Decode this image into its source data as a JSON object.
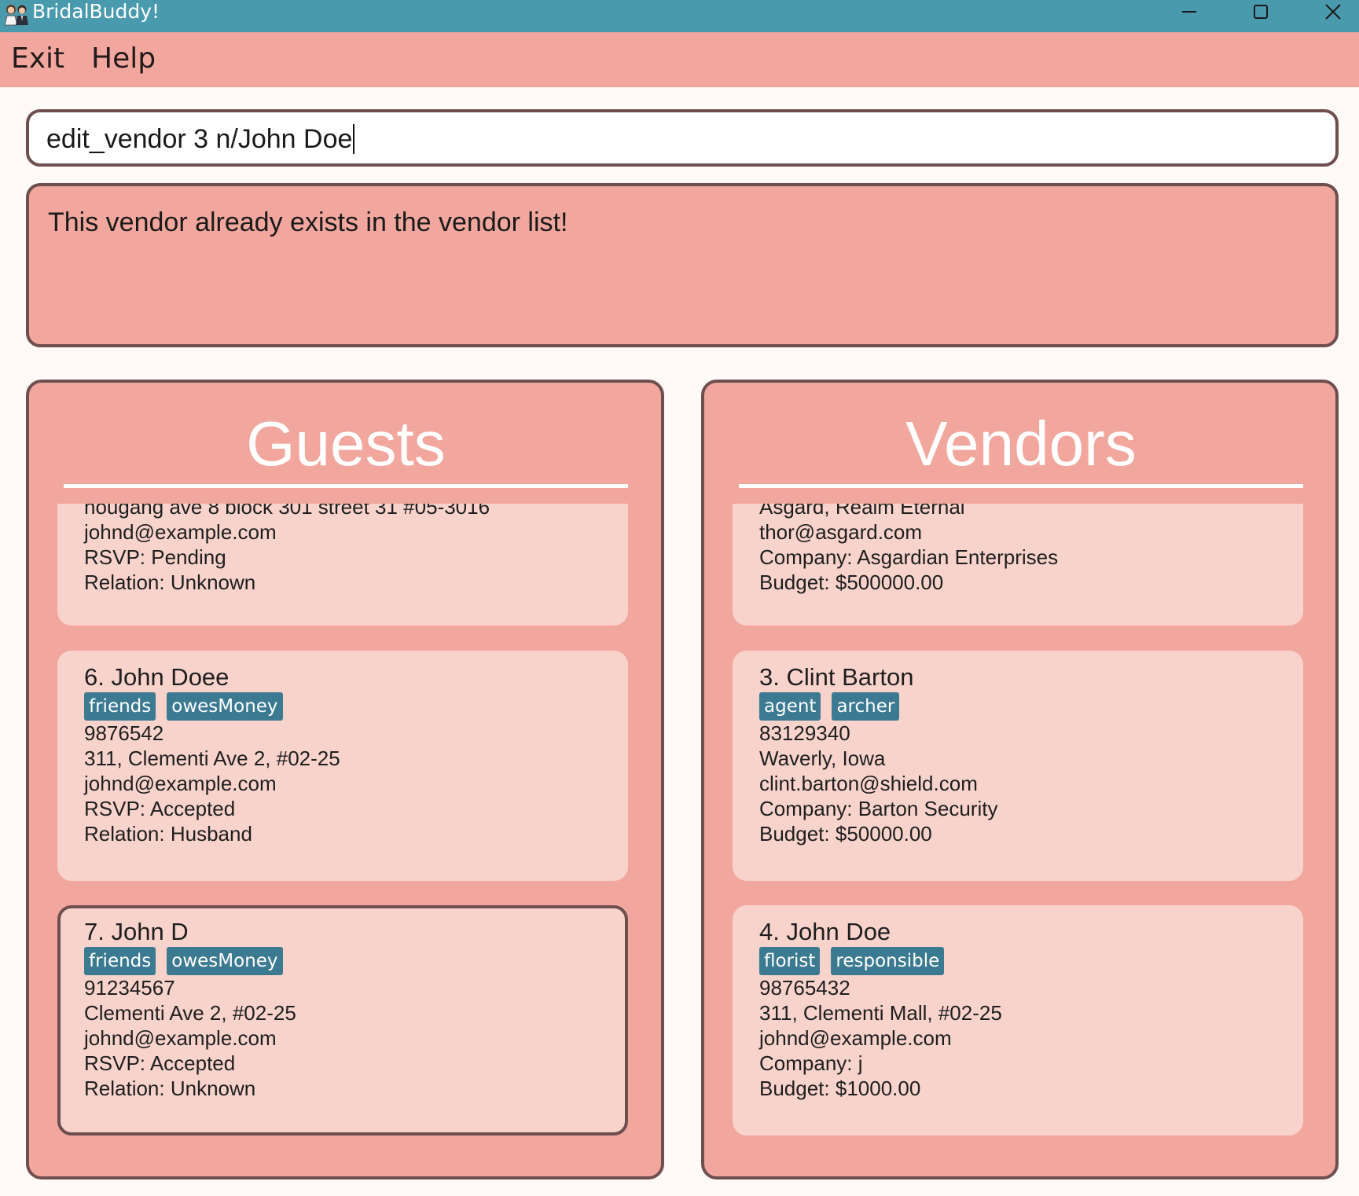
{
  "window": {
    "title": "BridalBuddy!",
    "icon": "bride-groom-icon",
    "controls": [
      "minimize-icon",
      "maximize-icon",
      "close-icon"
    ]
  },
  "menu": {
    "items": [
      "Exit",
      "Help"
    ]
  },
  "command": {
    "value": "edit_vendor 3 n/John Doe"
  },
  "result": {
    "message": "This vendor already exists in the vendor list!"
  },
  "guests": {
    "title": "Guests",
    "cards": [
      {
        "partial_top": "hougang ave 8 block 301 street 31 #05-3016",
        "name": "",
        "tags": [],
        "fields": [
          "johnd@example.com",
          "RSVP: Pending",
          "Relation: Unknown"
        ]
      },
      {
        "name": "6. John Doee",
        "tags": [
          "friends",
          "owesMoney"
        ],
        "fields": [
          "9876542",
          "311, Clementi Ave 2, #02-25",
          "johnd@example.com",
          "RSVP: Accepted",
          "Relation: Husband"
        ]
      },
      {
        "name": "7. John D",
        "tags": [
          "friends",
          "owesMoney"
        ],
        "fields": [
          "91234567",
          "Clementi Ave 2, #02-25",
          "johnd@example.com",
          "RSVP: Accepted",
          "Relation: Unknown"
        ],
        "selected": true
      }
    ]
  },
  "vendors": {
    "title": "Vendors",
    "cards": [
      {
        "partial_top": "Asgard, Realm Eternal",
        "name": "",
        "tags": [],
        "fields": [
          "thor@asgard.com",
          "Company: Asgardian Enterprises",
          "Budget: $500000.00"
        ]
      },
      {
        "name": "3. Clint Barton",
        "tags": [
          "agent",
          "archer"
        ],
        "fields": [
          "83129340",
          "Waverly, Iowa",
          "clint.barton@shield.com",
          "Company: Barton Security",
          "Budget: $50000.00"
        ]
      },
      {
        "name": "4. John Doe",
        "tags": [
          "florist",
          "responsible"
        ],
        "fields": [
          "98765432",
          "311, Clementi Mall, #02-25",
          "johnd@example.com",
          "Company: j",
          "Budget: $1000.00"
        ]
      }
    ]
  },
  "colors": {
    "titlebar": "#4A9AAE",
    "menubar": "#F2A79E",
    "panel": "#F2A79E",
    "card": "#F8D3CB",
    "tag": "#3B7A91",
    "border": "#6E4F4F"
  }
}
